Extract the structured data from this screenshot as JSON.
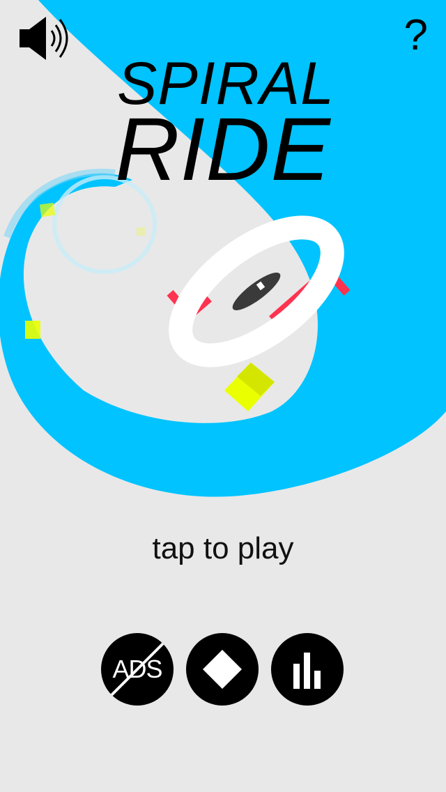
{
  "app": {
    "title_line_1": "SPIRAL",
    "title_line_2": "RIDE"
  },
  "top_bar": {
    "sound_icon": "speaker-on-icon",
    "help_label": "?"
  },
  "prompt": {
    "text": "tap to play"
  },
  "menu": {
    "no_ads_label": "ADS",
    "no_ads_icon": "no-ads-icon",
    "rate_icon": "diamond-icon",
    "leaderboard_icon": "bar-chart-icon"
  },
  "colors": {
    "background": "#e8e8e8",
    "track": "#00c3ff",
    "track_light": "#aee6f7",
    "pickup": "#eaff00",
    "obstacle": "#ff3350",
    "ring": "#ffffff",
    "player": "#3a3a3a",
    "button": "#000000"
  }
}
